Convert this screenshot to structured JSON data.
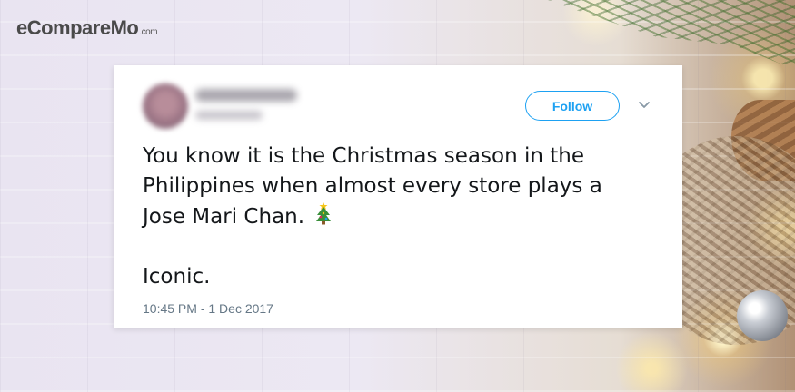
{
  "brand": {
    "logo_text": "eCompareMo",
    "logo_suffix": ".com"
  },
  "tweet": {
    "follow_label": "Follow",
    "text_line1": "You know it is the Christmas season in the",
    "text_line2": "Philippines when almost every store plays a",
    "text_line3": "Jose Mari Chan.",
    "emoji": "christmas-tree-icon",
    "text_line4": "Iconic.",
    "timestamp": "10:45 PM - 1 Dec 2017"
  },
  "colors": {
    "accent": "#1da1f2",
    "text": "#14171a",
    "muted": "#657786"
  }
}
